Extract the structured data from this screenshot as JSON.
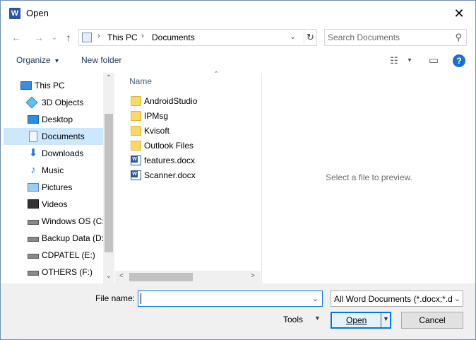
{
  "window": {
    "title": "Open",
    "app_icon_letter": "W",
    "close_glyph": "✕"
  },
  "nav": {
    "back_glyph": "←",
    "forward_glyph": "→",
    "recent_glyph": "⌄",
    "up_glyph": "↑",
    "breadcrumb": [
      "This PC",
      "Documents"
    ],
    "breadcrumb_sep": "›",
    "dropdown_glyph": "⌄",
    "refresh_glyph": "↻",
    "search_placeholder": "Search Documents",
    "search_glyph": "⚲"
  },
  "toolbar": {
    "organize_label": "Organize",
    "organize_arrow": "▾",
    "new_folder_label": "New folder",
    "view_glyph": "☷",
    "view_arrow": "▾",
    "pane_glyph": "▭",
    "help_glyph": "?"
  },
  "tree": {
    "items": [
      {
        "label": "This PC",
        "icon": "pc-icon",
        "selected": false
      },
      {
        "label": "3D Objects",
        "icon": "3d-objects-icon",
        "selected": false
      },
      {
        "label": "Desktop",
        "icon": "desktop-icon",
        "selected": false
      },
      {
        "label": "Documents",
        "icon": "documents-icon",
        "selected": true
      },
      {
        "label": "Downloads",
        "icon": "downloads-icon",
        "selected": false
      },
      {
        "label": "Music",
        "icon": "music-icon",
        "selected": false
      },
      {
        "label": "Pictures",
        "icon": "pictures-icon",
        "selected": false
      },
      {
        "label": "Videos",
        "icon": "videos-icon",
        "selected": false
      },
      {
        "label": "Windows OS (C:)",
        "icon": "drive-icon",
        "selected": false
      },
      {
        "label": "Backup Data (D:)",
        "icon": "drive-icon",
        "selected": false
      },
      {
        "label": "CDPATEL (E:)",
        "icon": "drive-icon",
        "selected": false
      },
      {
        "label": "OTHERS (F:)",
        "icon": "drive-icon",
        "selected": false
      }
    ],
    "scroll_up": "⌃",
    "scroll_down": "⌄"
  },
  "files": {
    "column_name": "Name",
    "sort_glyph": "⌃",
    "items": [
      {
        "name": "AndroidStudio",
        "type": "folder"
      },
      {
        "name": "IPMsg",
        "type": "folder"
      },
      {
        "name": "Kvisoft",
        "type": "folder"
      },
      {
        "name": "Outlook Files",
        "type": "folder"
      },
      {
        "name": "features.docx",
        "type": "docx"
      },
      {
        "name": "Scanner.docx",
        "type": "docx"
      }
    ],
    "hscroll_left": "<",
    "hscroll_right": ">"
  },
  "preview": {
    "text": "Select a file to preview."
  },
  "bottom": {
    "file_name_label": "File name:",
    "file_name_value": "",
    "file_name_dd": "⌄",
    "filter_label": "All Word Documents (*.docx;*.d",
    "filter_dd": "⌄",
    "tools_label": "Tools",
    "tools_dd": "▼",
    "open_label": "Open",
    "open_dd": "▼",
    "cancel_label": "Cancel"
  },
  "colors": {
    "accent": "#0078d7",
    "selection": "#cce8ff",
    "folder": "#ffd767",
    "word": "#2b579a"
  }
}
